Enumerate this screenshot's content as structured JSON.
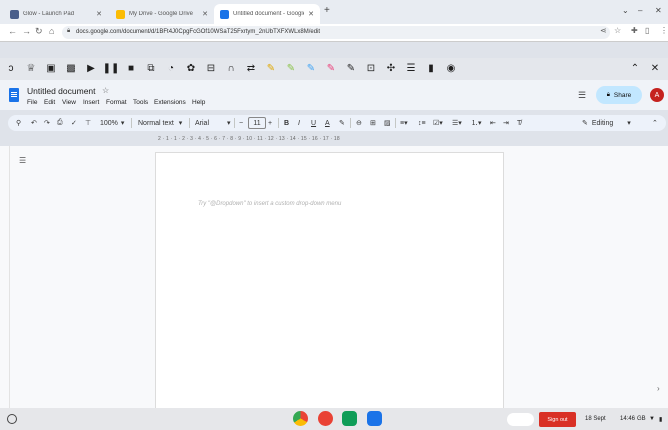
{
  "tabs": [
    {
      "title": "Glow - Launch Pad",
      "favicon_color": "#4a5e8a",
      "active": false
    },
    {
      "title": "My Drive - Google Drive",
      "favicon_color": "#fbbc04",
      "active": false
    },
    {
      "title": "Untitled document - Google Docs",
      "favicon_color": "#1a73e8",
      "active": true
    }
  ],
  "new_tab_label": "+",
  "url": "docs.google.com/document/d/1BFt4J0CpgFcGOf10WSaT25Fxrtym_2nUbTXFXWLx8M/edit",
  "extension_icons": [
    "glow-icon",
    "tt-icon",
    "read-icon",
    "picture-icon",
    "play-icon",
    "pause-icon",
    "stop-icon",
    "screenshot-icon",
    "export-icon",
    "globe-icon",
    "translate-icon",
    "display-icon",
    "headphones-icon",
    "fonts-icon",
    "highlighter-yellow-icon",
    "highlighter-green-icon",
    "highlighter-blue-icon",
    "highlighter-pink-icon",
    "highlighter-purple-icon",
    "strike-icon",
    "puzzle-icon",
    "list-icon",
    "note-icon",
    "camera-icon"
  ],
  "docs": {
    "title": "Untitled document",
    "menus": [
      "File",
      "Edit",
      "View",
      "Insert",
      "Format",
      "Tools",
      "Extensions",
      "Help"
    ],
    "share_label": "Share",
    "avatar_letter": "A",
    "toolbar": {
      "zoom": "100%",
      "style": "Normal text",
      "font": "Arial",
      "font_size": "11",
      "mode": "Editing"
    },
    "ruler": "2 · 1 · 1 · 2 · 3 · 4 · 5 · 6 · 7 · 8 · 9 · 10 · 11 · 12 · 13 · 14 · 15 · 16 · 17 · 18",
    "hint": "Try \"@Dropdown\" to insert a custom drop-down menu"
  },
  "shelf": {
    "signout_label": "Sign out",
    "date": "18 Sept",
    "time": "14:46",
    "region": "GB"
  }
}
